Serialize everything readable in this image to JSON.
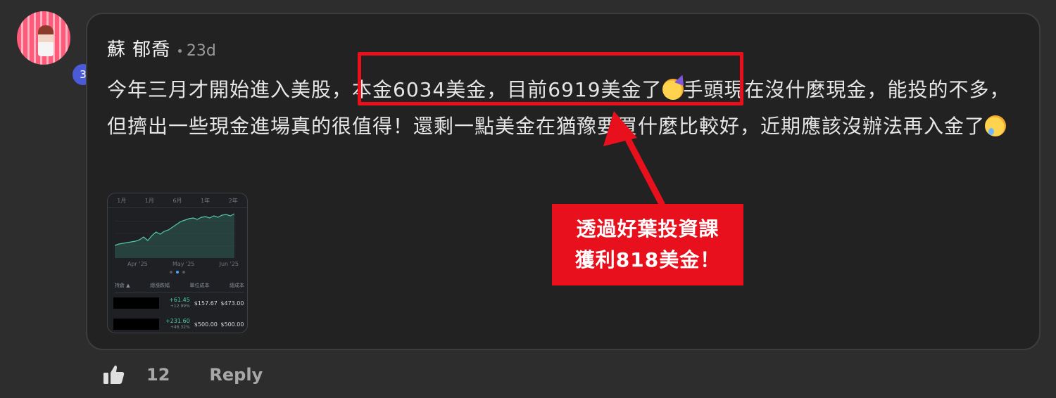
{
  "comment": {
    "badge_count": "3",
    "author": "蘇 郁喬",
    "time_separator": "•",
    "timestamp": "23d",
    "text_part1": "今年三月才開始進入美股，本金6034美金，目前6919美金了",
    "text_part2": "手頭現在沒什麼現金，能投的不多，但擠出一些現金進場真的很值得！還剩一點美金在猶豫要買什麼比較好，近期應該沒辦法再入金了",
    "emojis": [
      "partying-face",
      "smiling-face-with-tear"
    ]
  },
  "attachment": {
    "tabs": [
      "1月",
      "1月",
      "6月",
      "1年",
      "2年"
    ],
    "x_axis": [
      "Apr '25",
      "May '25",
      "Jun '25"
    ],
    "table_headers": [
      "持倉 ▲",
      "總漲跌幅",
      "單位成本",
      "總成本"
    ],
    "rows": [
      {
        "change": "+61.45",
        "change_pct": "+12.99%",
        "unit_cost": "$157.67",
        "total_cost": "$473.00"
      },
      {
        "change": "+231.60",
        "change_pct": "+46.32%",
        "unit_cost": "$500.00",
        "total_cost": "$500.00"
      }
    ],
    "chart_points": [
      52,
      50,
      49,
      48,
      47,
      46,
      44,
      40,
      45,
      38,
      33,
      36,
      32,
      30,
      26,
      22,
      18,
      16,
      14,
      13,
      15,
      12,
      11,
      13,
      10,
      12,
      9,
      8,
      10,
      7
    ]
  },
  "actions": {
    "like_count": "12",
    "reply_label": "Reply"
  },
  "annotation": {
    "callout_line1": "透過好葉投資課",
    "callout_line2": "獲利818美金！",
    "highlight_color": "#e8101c"
  }
}
